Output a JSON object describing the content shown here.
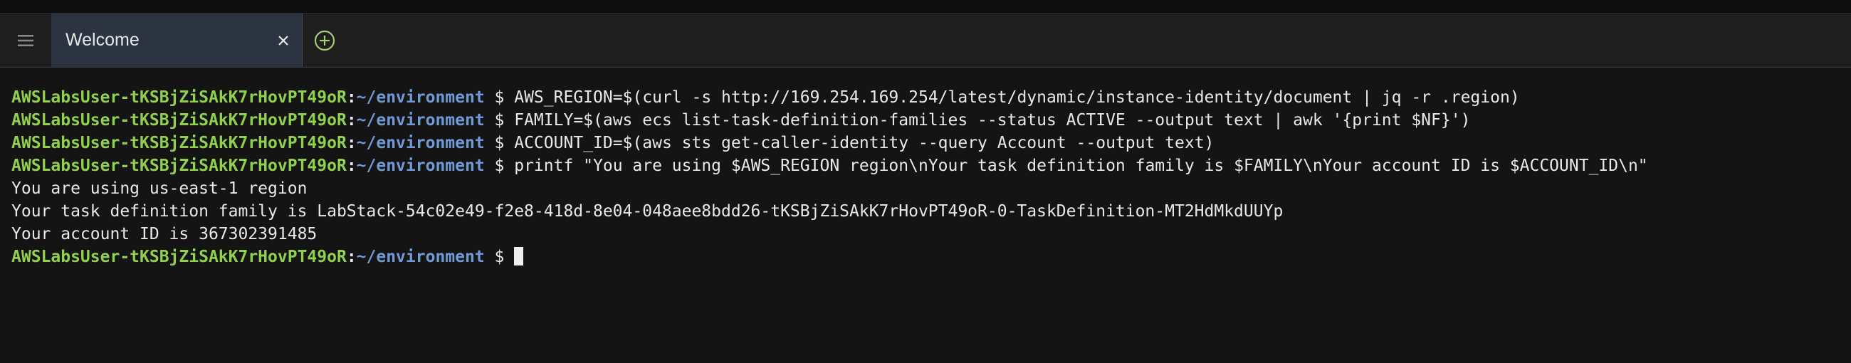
{
  "tabs": [
    {
      "label": "Welcome",
      "active": true
    }
  ],
  "icons": {
    "menu": "hamburger-menu-icon",
    "close": "close-icon",
    "add": "add-tab-icon"
  },
  "colors": {
    "prompt_user": "#8fd14f",
    "prompt_path": "#6f9ad6",
    "terminal_bg": "#141414",
    "active_tab_bg": "#2b3440"
  },
  "terminal": {
    "prompt": {
      "user": "AWSLabsUser-tKSBjZiSAkK7rHovPT49oR",
      "path": "~/environment",
      "symbol": "$"
    },
    "lines": [
      {
        "type": "command",
        "text": "AWS_REGION=$(curl -s http://169.254.169.254/latest/dynamic/instance-identity/document | jq -r .region)"
      },
      {
        "type": "command",
        "text": "FAMILY=$(aws ecs list-task-definition-families --status ACTIVE --output text | awk '{print $NF}')"
      },
      {
        "type": "command",
        "text": "ACCOUNT_ID=$(aws sts get-caller-identity --query Account --output text)"
      },
      {
        "type": "command",
        "text": "printf \"You are using $AWS_REGION region\\nYour task definition family is $FAMILY\\nYour account ID is $ACCOUNT_ID\\n\""
      },
      {
        "type": "output",
        "text": "You are using us-east-1 region"
      },
      {
        "type": "output",
        "text": "Your task definition family is LabStack-54c02e49-f2e8-418d-8e04-048aee8bdd26-tKSBjZiSAkK7rHovPT49oR-0-TaskDefinition-MT2HdMkdUUYp"
      },
      {
        "type": "output",
        "text": "Your account ID is 367302391485"
      },
      {
        "type": "prompt",
        "text": ""
      }
    ]
  }
}
